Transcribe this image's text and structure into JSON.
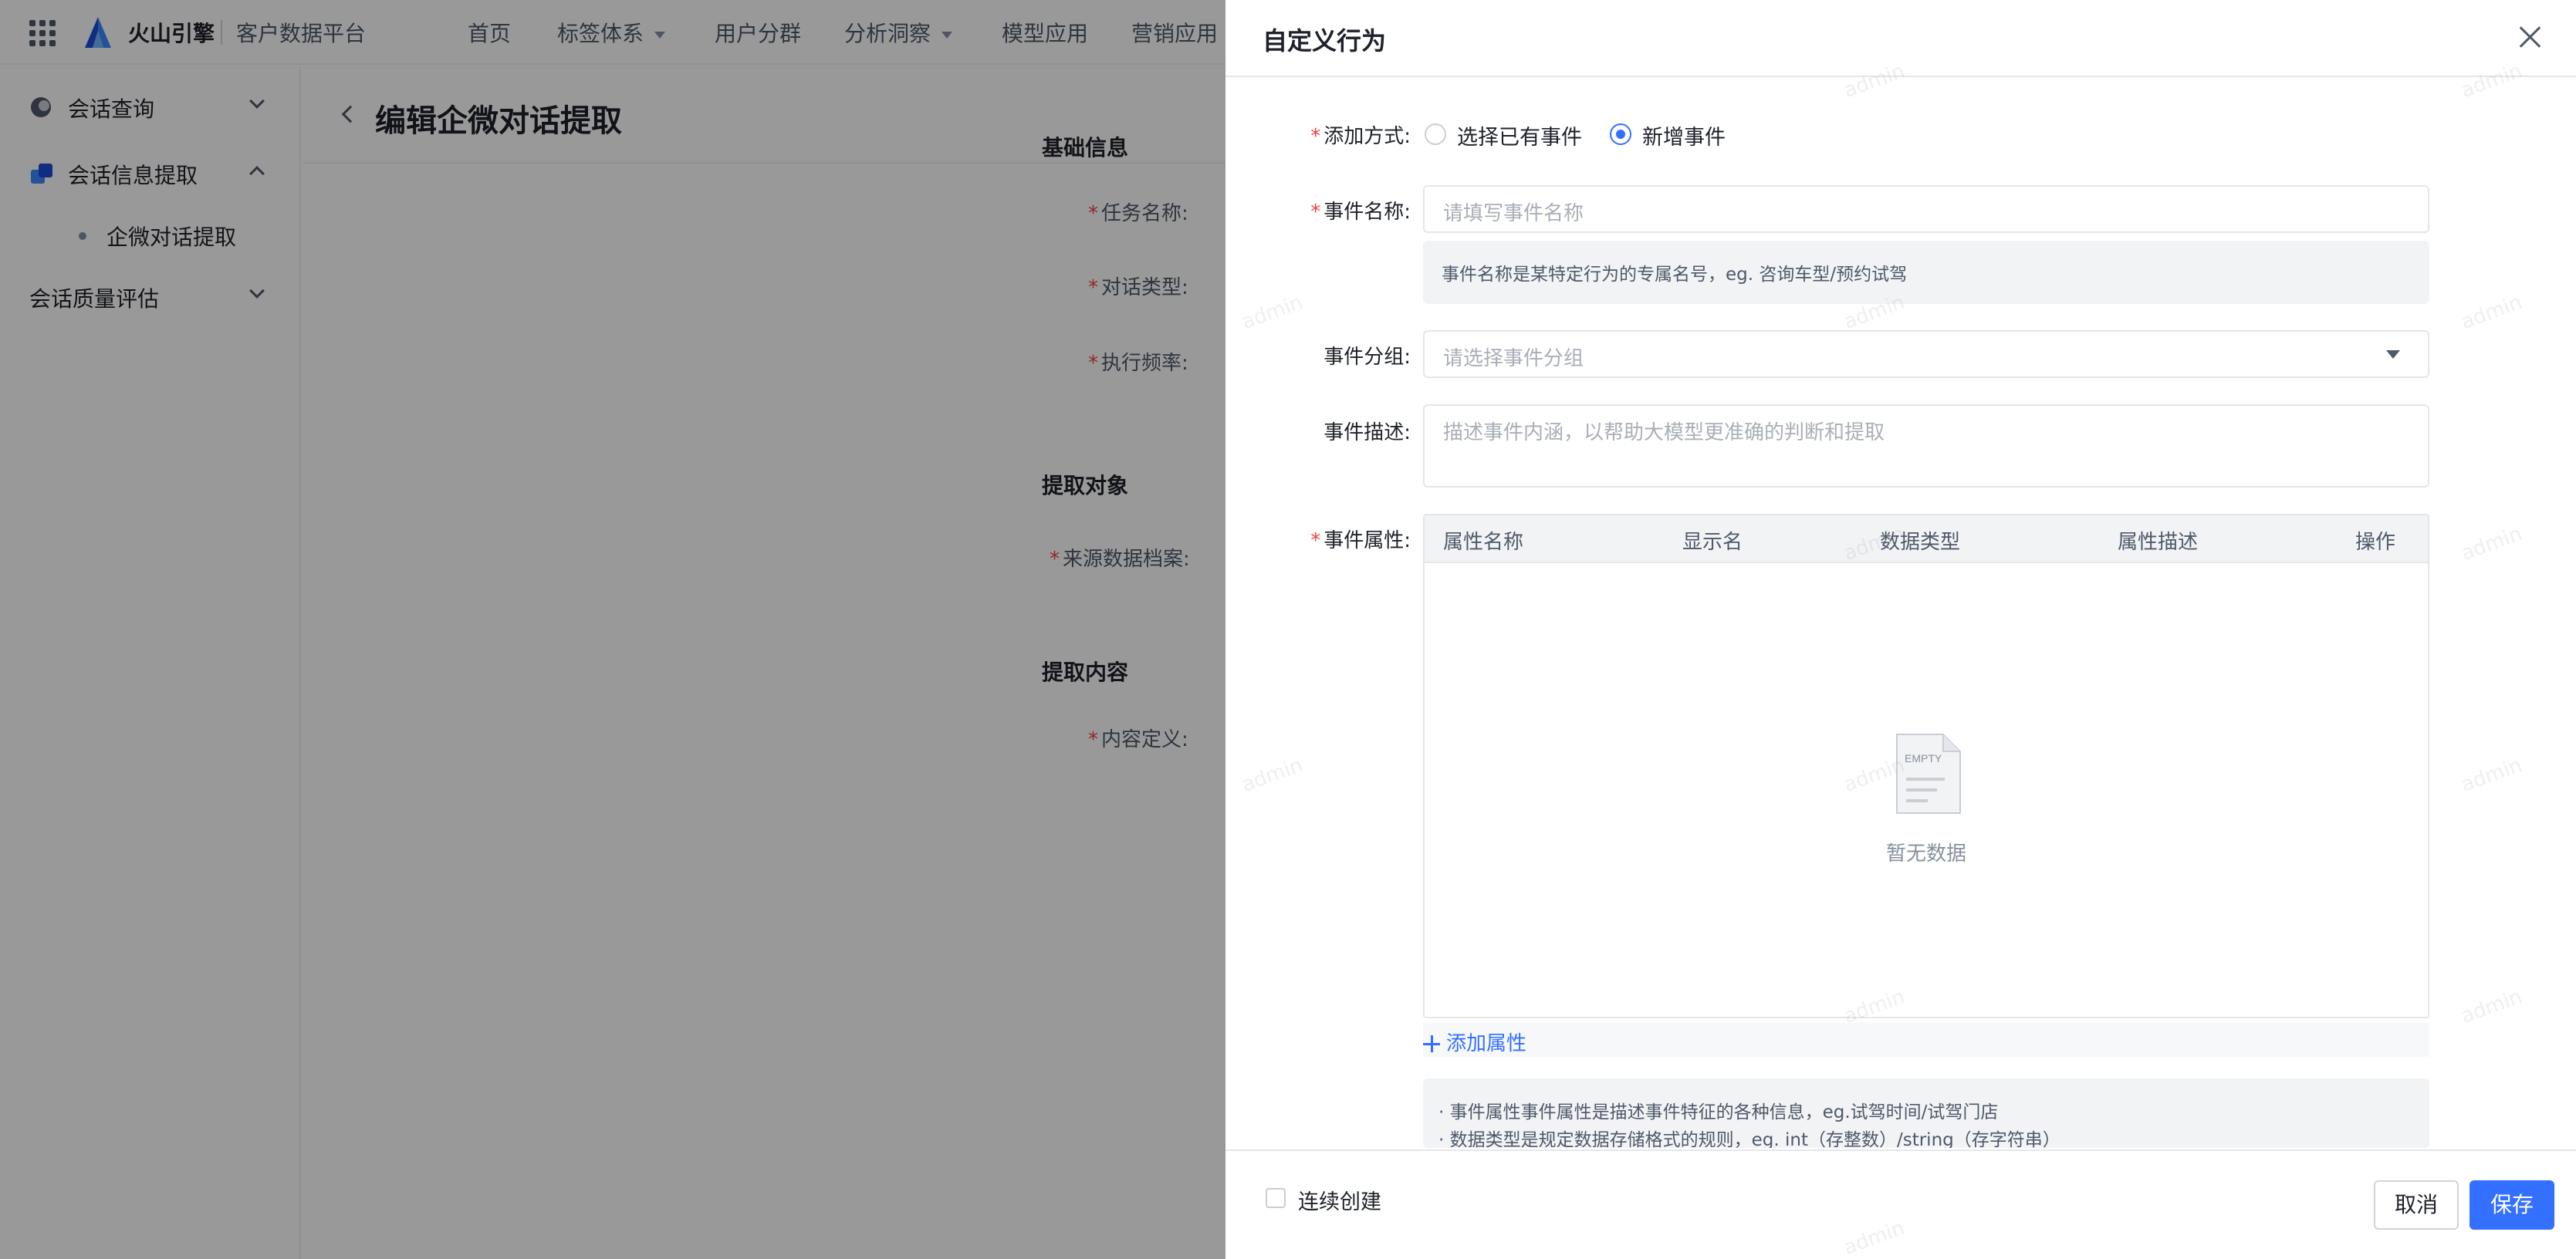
{
  "app": {
    "brand": "火山引擎",
    "product": "客户数据平台"
  },
  "nav": [
    {
      "label": "首页",
      "dropdown": false
    },
    {
      "label": "标签体系",
      "dropdown": true
    },
    {
      "label": "用户分群",
      "dropdown": false
    },
    {
      "label": "分析洞察",
      "dropdown": true
    },
    {
      "label": "模型应用",
      "dropdown": false
    },
    {
      "label": "营销应用",
      "dropdown": false
    }
  ],
  "sidebar": {
    "items": [
      {
        "label": "会话查询",
        "expanded": false
      },
      {
        "label": "会话信息提取",
        "expanded": true
      },
      {
        "label": "企微对话提取",
        "child": true
      },
      {
        "label": "会话质量评估",
        "expanded": false
      }
    ]
  },
  "main": {
    "title": "编辑企微对话提取",
    "sections": [
      {
        "title": "基础信息",
        "fields": [
          "任务名称:",
          "对话类型:",
          "执行频率:"
        ]
      },
      {
        "title": "提取对象",
        "fields": [
          "来源数据档案:"
        ]
      },
      {
        "title": "提取内容",
        "fields": [
          "内容定义:"
        ]
      }
    ]
  },
  "drawer": {
    "title": "自定义行为",
    "add_method": {
      "label": "添加方式:",
      "options": [
        "选择已有事件",
        "新增事件"
      ],
      "selected": "新增事件"
    },
    "event_name": {
      "label": "事件名称:",
      "placeholder": "请填写事件名称",
      "hint": "事件名称是某特定行为的专属名号，eg. 咨询车型/预约试驾"
    },
    "event_group": {
      "label": "事件分组:",
      "placeholder": "请选择事件分组"
    },
    "event_desc": {
      "label": "事件描述:",
      "placeholder": "描述事件内涵，以帮助大模型更准确的判断和提取"
    },
    "event_attrs": {
      "label": "事件属性:",
      "columns": [
        "属性名称",
        "显示名",
        "数据类型",
        "属性描述",
        "操作"
      ],
      "empty_icon_text": "EMPTY",
      "empty_text": "暂无数据",
      "add_label": "添加属性"
    },
    "notes": [
      "· 事件属性事件属性是描述事件特征的各种信息，eg.试驾时间/试驾门店",
      "· 数据类型是规定数据存储格式的规则，eg. int（存整数）/string（存字符串）"
    ],
    "footer": {
      "continuous_label": "连续创建",
      "cancel_label": "取消",
      "save_label": "保存"
    }
  },
  "watermark": "admin",
  "colors": {
    "accent": "#3370ff",
    "required": "#f53f3f",
    "mask": "rgba(0,0,0,0.40)"
  }
}
